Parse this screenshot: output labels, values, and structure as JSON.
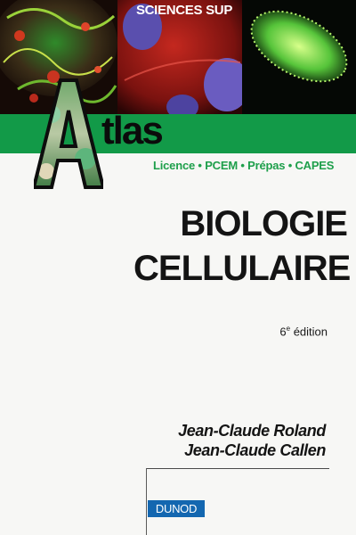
{
  "cover": {
    "series": "SCIENCES SUP",
    "logo_letter": "A",
    "collection": "tlas",
    "audience": "Licence • PCEM • Prépas • CAPES",
    "title_lines": [
      "BIOLOGIE",
      "CELLULAIRE"
    ],
    "edition_number": "6",
    "edition_suffix": "e",
    "edition_word": " édition",
    "authors": [
      "Jean-Claude Roland",
      "Jean-Claude Callen"
    ],
    "publisher": "DUNOD"
  },
  "colors": {
    "band_green": "#129a48",
    "audience_green": "#1e9f4b",
    "publisher_blue": "#1467b0",
    "background": "#f7f7f5"
  },
  "icons": {
    "logo": "atlas-a-logo",
    "micrographs": [
      "fluorescent-tissue-image",
      "red-cell-image",
      "green-paramecium-image"
    ]
  }
}
